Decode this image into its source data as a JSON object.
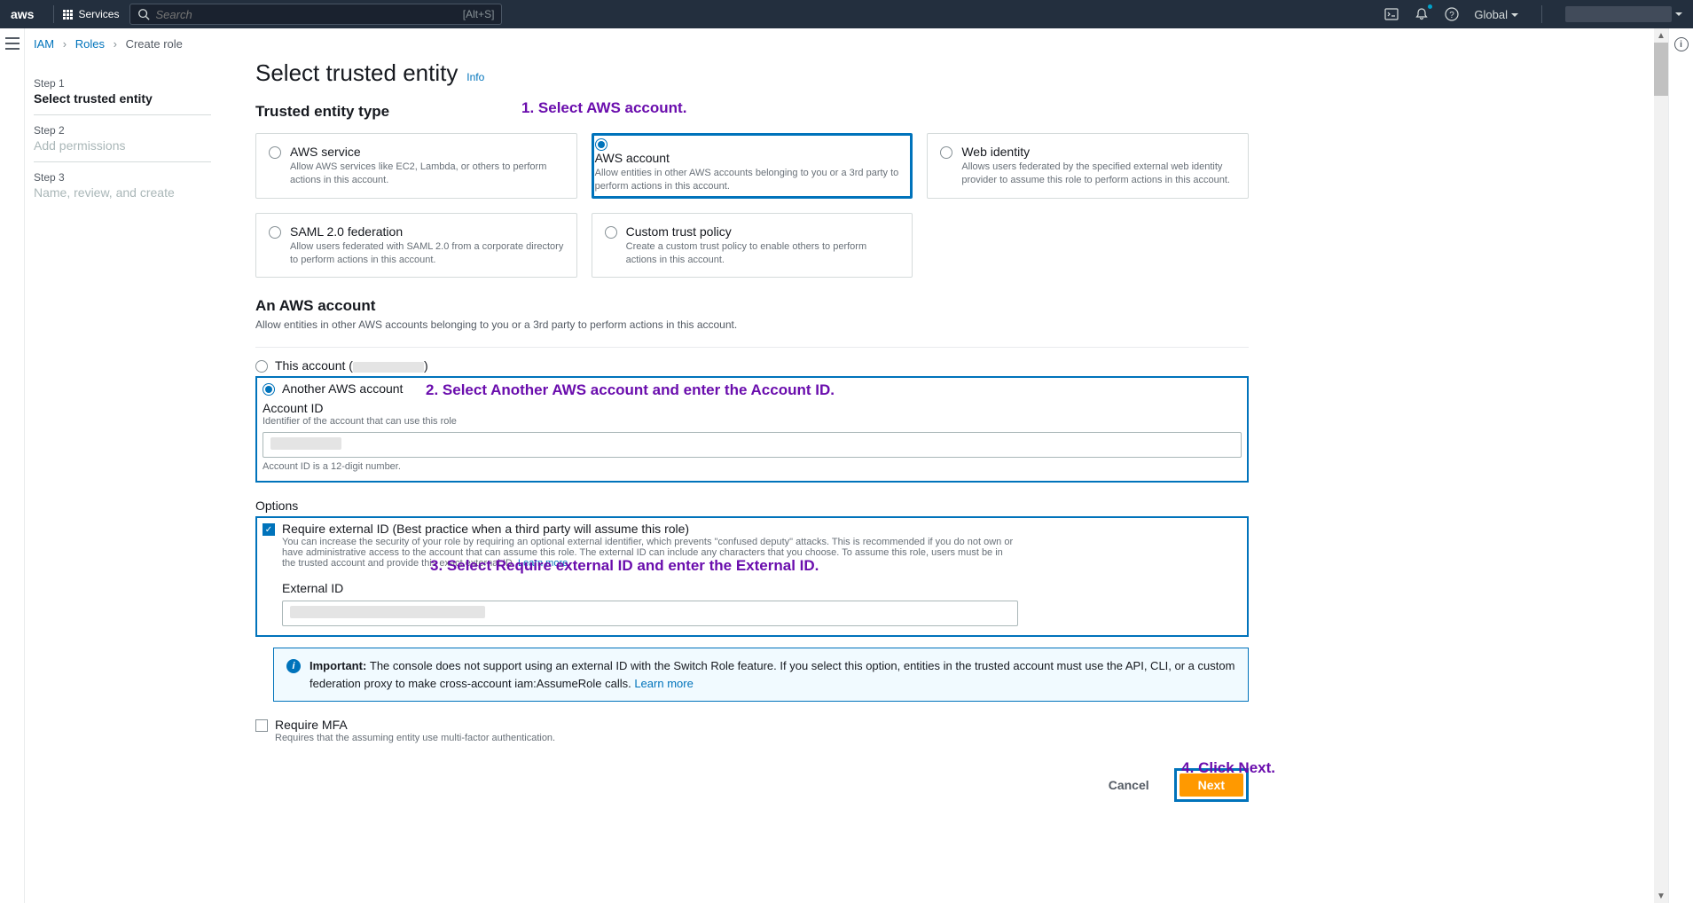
{
  "topnav": {
    "logo": "aws",
    "services": "Services",
    "search_placeholder": "Search",
    "search_shortcut": "[Alt+S]",
    "region": "Global"
  },
  "breadcrumb": {
    "iam": "IAM",
    "roles": "Roles",
    "create": "Create role"
  },
  "wizard": {
    "s1_lbl": "Step 1",
    "s1_title": "Select trusted entity",
    "s2_lbl": "Step 2",
    "s2_title": "Add permissions",
    "s3_lbl": "Step 3",
    "s3_title": "Name, review, and create"
  },
  "page": {
    "heading": "Select trusted entity",
    "info": "Info",
    "entity_type_heading": "Trusted entity type"
  },
  "annotations": {
    "a1": "1. Select AWS account.",
    "a2": "2. Select Another AWS account and enter the Account ID.",
    "a3": "3. Select Require external ID and enter the External ID.",
    "a4": "4. Click Next."
  },
  "cards": {
    "svc_t": "AWS service",
    "svc_d": "Allow AWS services like EC2, Lambda, or others to perform actions in this account.",
    "acct_t": "AWS account",
    "acct_d": "Allow entities in other AWS accounts belonging to you or a 3rd party to perform actions in this account.",
    "web_t": "Web identity",
    "web_d": "Allows users federated by the specified external web identity provider to assume this role to perform actions in this account.",
    "saml_t": "SAML 2.0 federation",
    "saml_d": "Allow users federated with SAML 2.0 from a corporate directory to perform actions in this account.",
    "cust_t": "Custom trust policy",
    "cust_d": "Create a custom trust policy to enable others to perform actions in this account."
  },
  "account_section": {
    "heading": "An AWS account",
    "sub": "Allow entities in other AWS accounts belonging to you or a 3rd party to perform actions in this account.",
    "this_account_pre": "This account (",
    "this_account_post": ")",
    "another": "Another AWS account",
    "acct_id_lbl": "Account ID",
    "acct_id_desc": "Identifier of the account that can use this role",
    "acct_id_hint": "Account ID is a 12-digit number."
  },
  "options": {
    "heading": "Options",
    "req_ext_lbl": "Require external ID (Best practice when a third party will assume this role)",
    "req_ext_desc": "You can increase the security of your role by requiring an optional external identifier, which prevents \"confused deputy\" attacks. This is recommended if you do not own or have administrative access to the account that can assume this role. The external ID can include any characters that you choose. To assume this role, users must be in the trusted account and provide this exact external ID. ",
    "learn_more": "Learn more",
    "ext_id_lbl": "External ID",
    "banner_pre": "Important: ",
    "banner_txt": "The console does not support using an external ID with the Switch Role feature. If you select this option, entities in the trusted account must use the API, CLI, or a custom federation proxy to make cross-account iam:AssumeRole calls. ",
    "mfa_lbl": "Require MFA",
    "mfa_desc": "Requires that the assuming entity use multi-factor authentication."
  },
  "buttons": {
    "cancel": "Cancel",
    "next": "Next"
  }
}
